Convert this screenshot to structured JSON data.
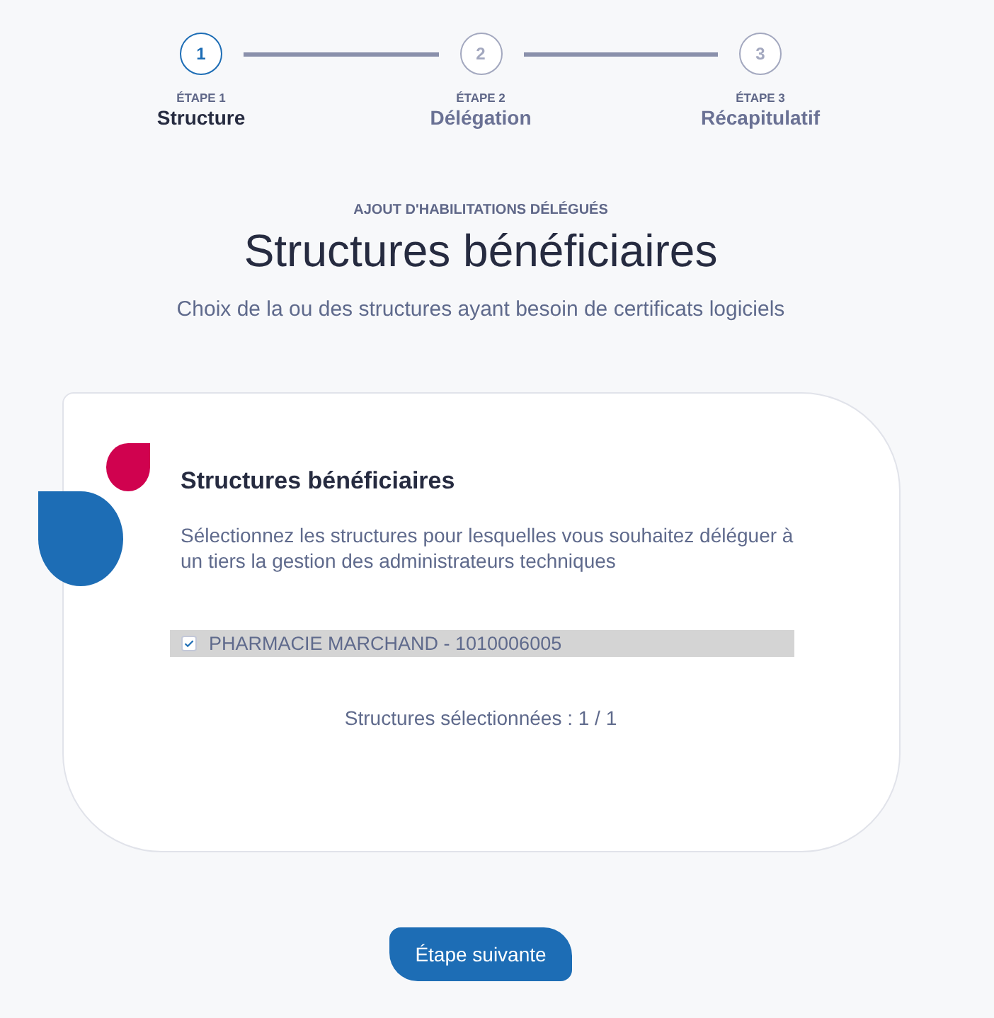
{
  "stepper": {
    "steps": [
      {
        "number": "1",
        "caption": "ÉTAPE 1",
        "label": "Structure",
        "selected": true
      },
      {
        "number": "2",
        "caption": "ÉTAPE 2",
        "label": "Délégation",
        "selected": false
      },
      {
        "number": "3",
        "caption": "ÉTAPE 3",
        "label": "Récapitulatif",
        "selected": false
      }
    ]
  },
  "header": {
    "eyebrow": "AJOUT D'HABILITATIONS DÉLÉGUÉS",
    "title": "Structures bénéficiaires",
    "subtitle": "Choix de la ou des structures ayant besoin de certificats logiciels"
  },
  "card": {
    "title": "Structures bénéficiaires",
    "description": "Sélectionnez les structures pour lesquelles vous souhaitez déléguer à un tiers la gestion des administrateurs techniques",
    "structures": [
      {
        "label": "PHARMACIE MARCHAND - 1010006005",
        "checked": true
      }
    ],
    "selection_count": "Structures sélectionnées : 1 / 1"
  },
  "next_button": {
    "label": "Étape suivante"
  }
}
